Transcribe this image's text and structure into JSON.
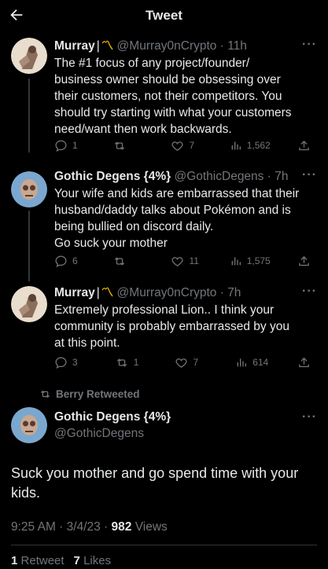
{
  "header": {
    "title": "Tweet"
  },
  "tweets": [
    {
      "name": "Murray",
      "badge": "〽",
      "handle": "@Murray0nCrypto",
      "time": "11h",
      "lines": [
        "The #1 focus of any project/founder/",
        "business owner should be obsessing over",
        "their customers, not their competitors. You",
        "should try starting with what your customers",
        "need/want then work backwards."
      ],
      "replies": "1",
      "retweets": "",
      "likes": "7",
      "views": "1,562"
    },
    {
      "name": "Gothic Degens {4%}",
      "handle": "@GothicDegens",
      "time": "7h",
      "lines": [
        "Your wife and kids are embarrassed that their",
        "husband/daddy talks about Pokémon and is",
        "being bullied on discord daily.",
        "Go suck your mother"
      ],
      "replies": "6",
      "retweets": "",
      "likes": "11",
      "views": "1,575"
    },
    {
      "name": "Murray",
      "badge": "〽",
      "handle": "@Murray0nCrypto",
      "time": "7h",
      "lines": [
        "Extremely professional Lion.. I think your",
        "community is probably embarrassed by you",
        "at this point."
      ],
      "replies": "3",
      "retweets": "1",
      "likes": "7",
      "views": "614"
    }
  ],
  "retweeted_by": "Berry Retweeted",
  "main_tweet": {
    "name": "Gothic Degens {4%}",
    "handle": "@GothicDegens",
    "lines": [
      "Suck you mother and go spend time with your",
      "kids."
    ],
    "timestamp": "9:25 AM · 3/4/23 · ",
    "views_count": "982",
    "views_label": " Views",
    "retweet_count": "1",
    "retweet_label": "Retweet",
    "like_count": "7",
    "like_label": "Likes"
  },
  "colors": {
    "background": "#000000",
    "text": "#e7e9ea",
    "muted": "#71767b",
    "badge": "#f7b500"
  }
}
